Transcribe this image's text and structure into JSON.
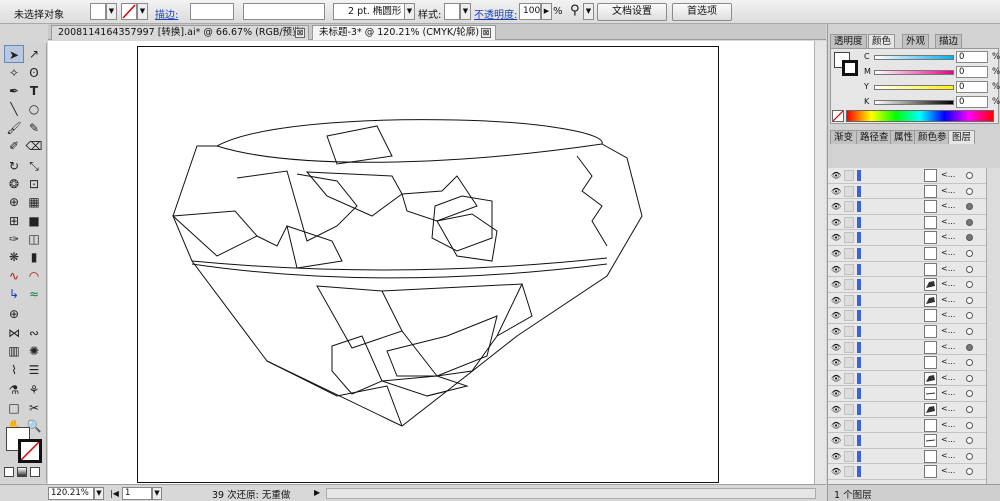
{
  "control_bar": {
    "selection_status": "未选择对象",
    "stroke_label": "描边:",
    "stroke_profile": "2 pt. 椭圆形",
    "style_label": "样式:",
    "opacity_label": "不透明度:",
    "opacity_value": "100",
    "opacity_unit": "%",
    "doc_setup_button": "文档设置",
    "prefs_button": "首选项"
  },
  "tabs": [
    {
      "label": "2008114164357997 [转换].ai* @ 66.67% (RGB/预览)",
      "close": "⊠"
    },
    {
      "label": "未标题-3* @ 120.21% (CMYK/轮廓)",
      "close": "⊠"
    }
  ],
  "status_bar": {
    "zoom": "120.21%",
    "page": "1",
    "history": "39 次还原: 无重做"
  },
  "color_panel": {
    "tabs": [
      "透明度",
      "颜色",
      "外观",
      "描边"
    ],
    "channels": [
      {
        "label": "C",
        "value": "0",
        "unit": "%",
        "grad": "linear-gradient(90deg,#ffffff,#00aeef)"
      },
      {
        "label": "M",
        "value": "0",
        "unit": "%",
        "grad": "linear-gradient(90deg,#ffffff,#ec008c)"
      },
      {
        "label": "Y",
        "value": "0",
        "unit": "%",
        "grad": "linear-gradient(90deg,#ffffff,#fff200)"
      },
      {
        "label": "K",
        "value": "0",
        "unit": "%",
        "grad": "linear-gradient(90deg,#ffffff,#000000)"
      }
    ]
  },
  "layers_panel": {
    "tabs": [
      "渐变",
      "路径查",
      "属性",
      "颜色参",
      "图层"
    ],
    "rows": [
      {
        "name": "<...",
        "thumb": "",
        "circle_filled": false
      },
      {
        "name": "<...",
        "thumb": "",
        "circle_filled": false
      },
      {
        "name": "<...",
        "thumb": "",
        "circle_filled": true
      },
      {
        "name": "<...",
        "thumb": "",
        "circle_filled": true
      },
      {
        "name": "<...",
        "thumb": "",
        "circle_filled": true
      },
      {
        "name": "<...",
        "thumb": "",
        "circle_filled": false
      },
      {
        "name": "<...",
        "thumb": "",
        "circle_filled": false
      },
      {
        "name": "<...",
        "thumb": "shape",
        "circle_filled": false
      },
      {
        "name": "<...",
        "thumb": "shape",
        "circle_filled": false
      },
      {
        "name": "<...",
        "thumb": "",
        "circle_filled": false
      },
      {
        "name": "<...",
        "thumb": "",
        "circle_filled": false
      },
      {
        "name": "<...",
        "thumb": "",
        "circle_filled": true
      },
      {
        "name": "<...",
        "thumb": "",
        "circle_filled": false
      },
      {
        "name": "<...",
        "thumb": "shape",
        "circle_filled": false
      },
      {
        "name": "<...",
        "thumb": "line",
        "circle_filled": false
      },
      {
        "name": "<...",
        "thumb": "shape",
        "circle_filled": false
      },
      {
        "name": "<...",
        "thumb": "",
        "circle_filled": false
      },
      {
        "name": "<...",
        "thumb": "line",
        "circle_filled": false
      },
      {
        "name": "<...",
        "thumb": "",
        "circle_filled": false
      },
      {
        "name": "<...",
        "thumb": "",
        "circle_filled": false
      }
    ],
    "layer_count": "1 个图层"
  }
}
